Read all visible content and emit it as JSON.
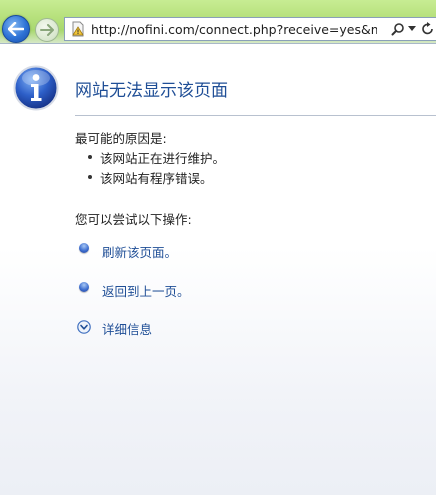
{
  "browser": {
    "url": "http://nofini.com/connect.php?receive=yes&mod="
  },
  "error_page": {
    "title": "网站无法显示该页面",
    "causes_heading": "最可能的原因是:",
    "causes": [
      "该网站正在进行维护。",
      "该网站有程序错误。"
    ],
    "actions_heading": "您可以尝试以下操作:",
    "actions": [
      "刷新该页面。",
      "返回到上一页。"
    ],
    "details_label": "详细信息"
  },
  "colors": {
    "link": "#1f4e96",
    "title": "#1f4e96",
    "chrome_green": "#b9e27f"
  },
  "icons": {
    "back": "back-arrow-icon",
    "forward": "forward-arrow-icon",
    "site": "page-warning-icon",
    "search": "search-icon",
    "dropdown": "chevron-down-icon",
    "refresh": "refresh-icon",
    "info": "info-icon",
    "details": "expand-chevron-icon"
  }
}
